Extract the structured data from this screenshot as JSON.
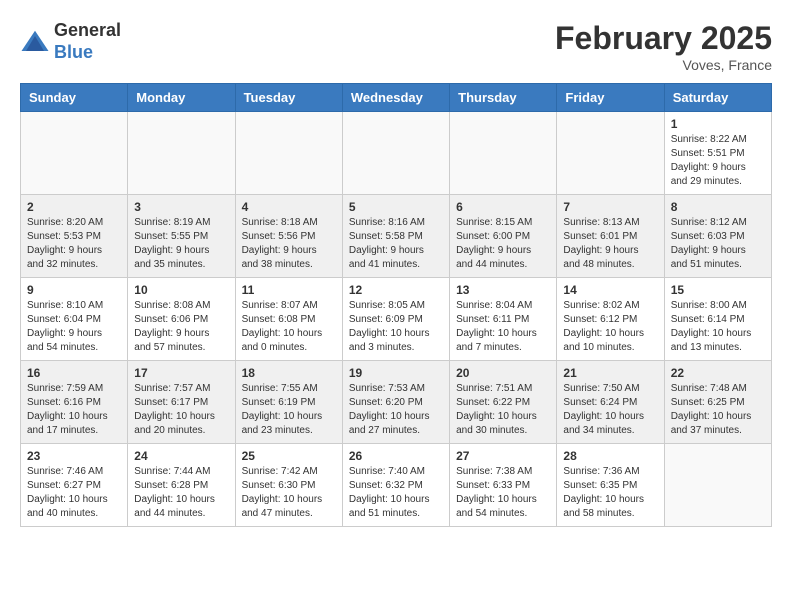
{
  "header": {
    "logo_general": "General",
    "logo_blue": "Blue",
    "month_title": "February 2025",
    "location": "Voves, France"
  },
  "weekdays": [
    "Sunday",
    "Monday",
    "Tuesday",
    "Wednesday",
    "Thursday",
    "Friday",
    "Saturday"
  ],
  "weeks": [
    {
      "shaded": false,
      "days": [
        {
          "num": "",
          "info": ""
        },
        {
          "num": "",
          "info": ""
        },
        {
          "num": "",
          "info": ""
        },
        {
          "num": "",
          "info": ""
        },
        {
          "num": "",
          "info": ""
        },
        {
          "num": "",
          "info": ""
        },
        {
          "num": "1",
          "info": "Sunrise: 8:22 AM\nSunset: 5:51 PM\nDaylight: 9 hours and 29 minutes."
        }
      ]
    },
    {
      "shaded": true,
      "days": [
        {
          "num": "2",
          "info": "Sunrise: 8:20 AM\nSunset: 5:53 PM\nDaylight: 9 hours and 32 minutes."
        },
        {
          "num": "3",
          "info": "Sunrise: 8:19 AM\nSunset: 5:55 PM\nDaylight: 9 hours and 35 minutes."
        },
        {
          "num": "4",
          "info": "Sunrise: 8:18 AM\nSunset: 5:56 PM\nDaylight: 9 hours and 38 minutes."
        },
        {
          "num": "5",
          "info": "Sunrise: 8:16 AM\nSunset: 5:58 PM\nDaylight: 9 hours and 41 minutes."
        },
        {
          "num": "6",
          "info": "Sunrise: 8:15 AM\nSunset: 6:00 PM\nDaylight: 9 hours and 44 minutes."
        },
        {
          "num": "7",
          "info": "Sunrise: 8:13 AM\nSunset: 6:01 PM\nDaylight: 9 hours and 48 minutes."
        },
        {
          "num": "8",
          "info": "Sunrise: 8:12 AM\nSunset: 6:03 PM\nDaylight: 9 hours and 51 minutes."
        }
      ]
    },
    {
      "shaded": false,
      "days": [
        {
          "num": "9",
          "info": "Sunrise: 8:10 AM\nSunset: 6:04 PM\nDaylight: 9 hours and 54 minutes."
        },
        {
          "num": "10",
          "info": "Sunrise: 8:08 AM\nSunset: 6:06 PM\nDaylight: 9 hours and 57 minutes."
        },
        {
          "num": "11",
          "info": "Sunrise: 8:07 AM\nSunset: 6:08 PM\nDaylight: 10 hours and 0 minutes."
        },
        {
          "num": "12",
          "info": "Sunrise: 8:05 AM\nSunset: 6:09 PM\nDaylight: 10 hours and 3 minutes."
        },
        {
          "num": "13",
          "info": "Sunrise: 8:04 AM\nSunset: 6:11 PM\nDaylight: 10 hours and 7 minutes."
        },
        {
          "num": "14",
          "info": "Sunrise: 8:02 AM\nSunset: 6:12 PM\nDaylight: 10 hours and 10 minutes."
        },
        {
          "num": "15",
          "info": "Sunrise: 8:00 AM\nSunset: 6:14 PM\nDaylight: 10 hours and 13 minutes."
        }
      ]
    },
    {
      "shaded": true,
      "days": [
        {
          "num": "16",
          "info": "Sunrise: 7:59 AM\nSunset: 6:16 PM\nDaylight: 10 hours and 17 minutes."
        },
        {
          "num": "17",
          "info": "Sunrise: 7:57 AM\nSunset: 6:17 PM\nDaylight: 10 hours and 20 minutes."
        },
        {
          "num": "18",
          "info": "Sunrise: 7:55 AM\nSunset: 6:19 PM\nDaylight: 10 hours and 23 minutes."
        },
        {
          "num": "19",
          "info": "Sunrise: 7:53 AM\nSunset: 6:20 PM\nDaylight: 10 hours and 27 minutes."
        },
        {
          "num": "20",
          "info": "Sunrise: 7:51 AM\nSunset: 6:22 PM\nDaylight: 10 hours and 30 minutes."
        },
        {
          "num": "21",
          "info": "Sunrise: 7:50 AM\nSunset: 6:24 PM\nDaylight: 10 hours and 34 minutes."
        },
        {
          "num": "22",
          "info": "Sunrise: 7:48 AM\nSunset: 6:25 PM\nDaylight: 10 hours and 37 minutes."
        }
      ]
    },
    {
      "shaded": false,
      "days": [
        {
          "num": "23",
          "info": "Sunrise: 7:46 AM\nSunset: 6:27 PM\nDaylight: 10 hours and 40 minutes."
        },
        {
          "num": "24",
          "info": "Sunrise: 7:44 AM\nSunset: 6:28 PM\nDaylight: 10 hours and 44 minutes."
        },
        {
          "num": "25",
          "info": "Sunrise: 7:42 AM\nSunset: 6:30 PM\nDaylight: 10 hours and 47 minutes."
        },
        {
          "num": "26",
          "info": "Sunrise: 7:40 AM\nSunset: 6:32 PM\nDaylight: 10 hours and 51 minutes."
        },
        {
          "num": "27",
          "info": "Sunrise: 7:38 AM\nSunset: 6:33 PM\nDaylight: 10 hours and 54 minutes."
        },
        {
          "num": "28",
          "info": "Sunrise: 7:36 AM\nSunset: 6:35 PM\nDaylight: 10 hours and 58 minutes."
        },
        {
          "num": "",
          "info": ""
        }
      ]
    }
  ]
}
